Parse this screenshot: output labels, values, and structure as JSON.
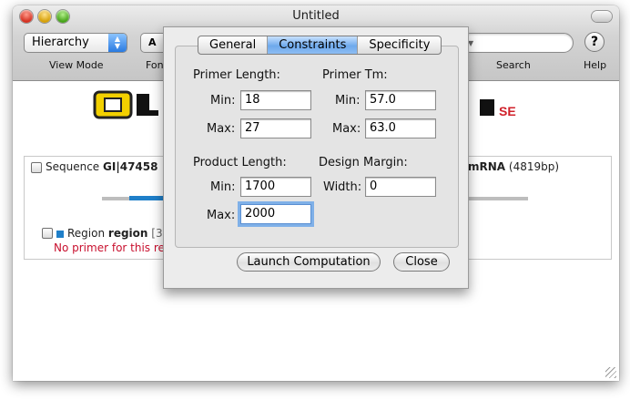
{
  "window": {
    "title": "Untitled"
  },
  "toolbar": {
    "view_mode_value": "Hierarchy",
    "font_button_text": "A",
    "labels": {
      "view_mode": "View Mode",
      "font": "Fon",
      "search": "Search",
      "help": "Help"
    },
    "help_glyph": "?"
  },
  "sequence": {
    "prefix": "Sequence ",
    "id": "GI|47458",
    "type": "mRNA",
    "length": "(4819bp)"
  },
  "region": {
    "prefix": "Region ",
    "name": "region",
    "coords": "[3",
    "message": "No primer for this region"
  },
  "sheet": {
    "tabs": [
      {
        "label": "General",
        "active": false
      },
      {
        "label": "Constraints",
        "active": true
      },
      {
        "label": "Specificity",
        "active": false
      }
    ],
    "primer_length": {
      "title": "Primer Length:",
      "min_label": "Min:",
      "min": "18",
      "max_label": "Max:",
      "max": "27"
    },
    "primer_tm": {
      "title": "Primer Tm:",
      "min_label": "Min:",
      "min": "57.0",
      "max_label": "Max:",
      "max": "63.0"
    },
    "product_length": {
      "title": "Product Length:",
      "min_label": "Min:",
      "min": "1700",
      "max_label": "Max:",
      "max": "2000"
    },
    "design_margin": {
      "title": "Design Margin:",
      "width_label": "Width:",
      "width": "0"
    },
    "buttons": {
      "launch": "Launch Computation",
      "close": "Close"
    }
  },
  "colors": {
    "accent": "#1f7fc9",
    "error": "#c8102e",
    "tab_active": "#6ea9ec",
    "logo_yellow": "#f2d000",
    "logo_red": "#d0202a"
  }
}
